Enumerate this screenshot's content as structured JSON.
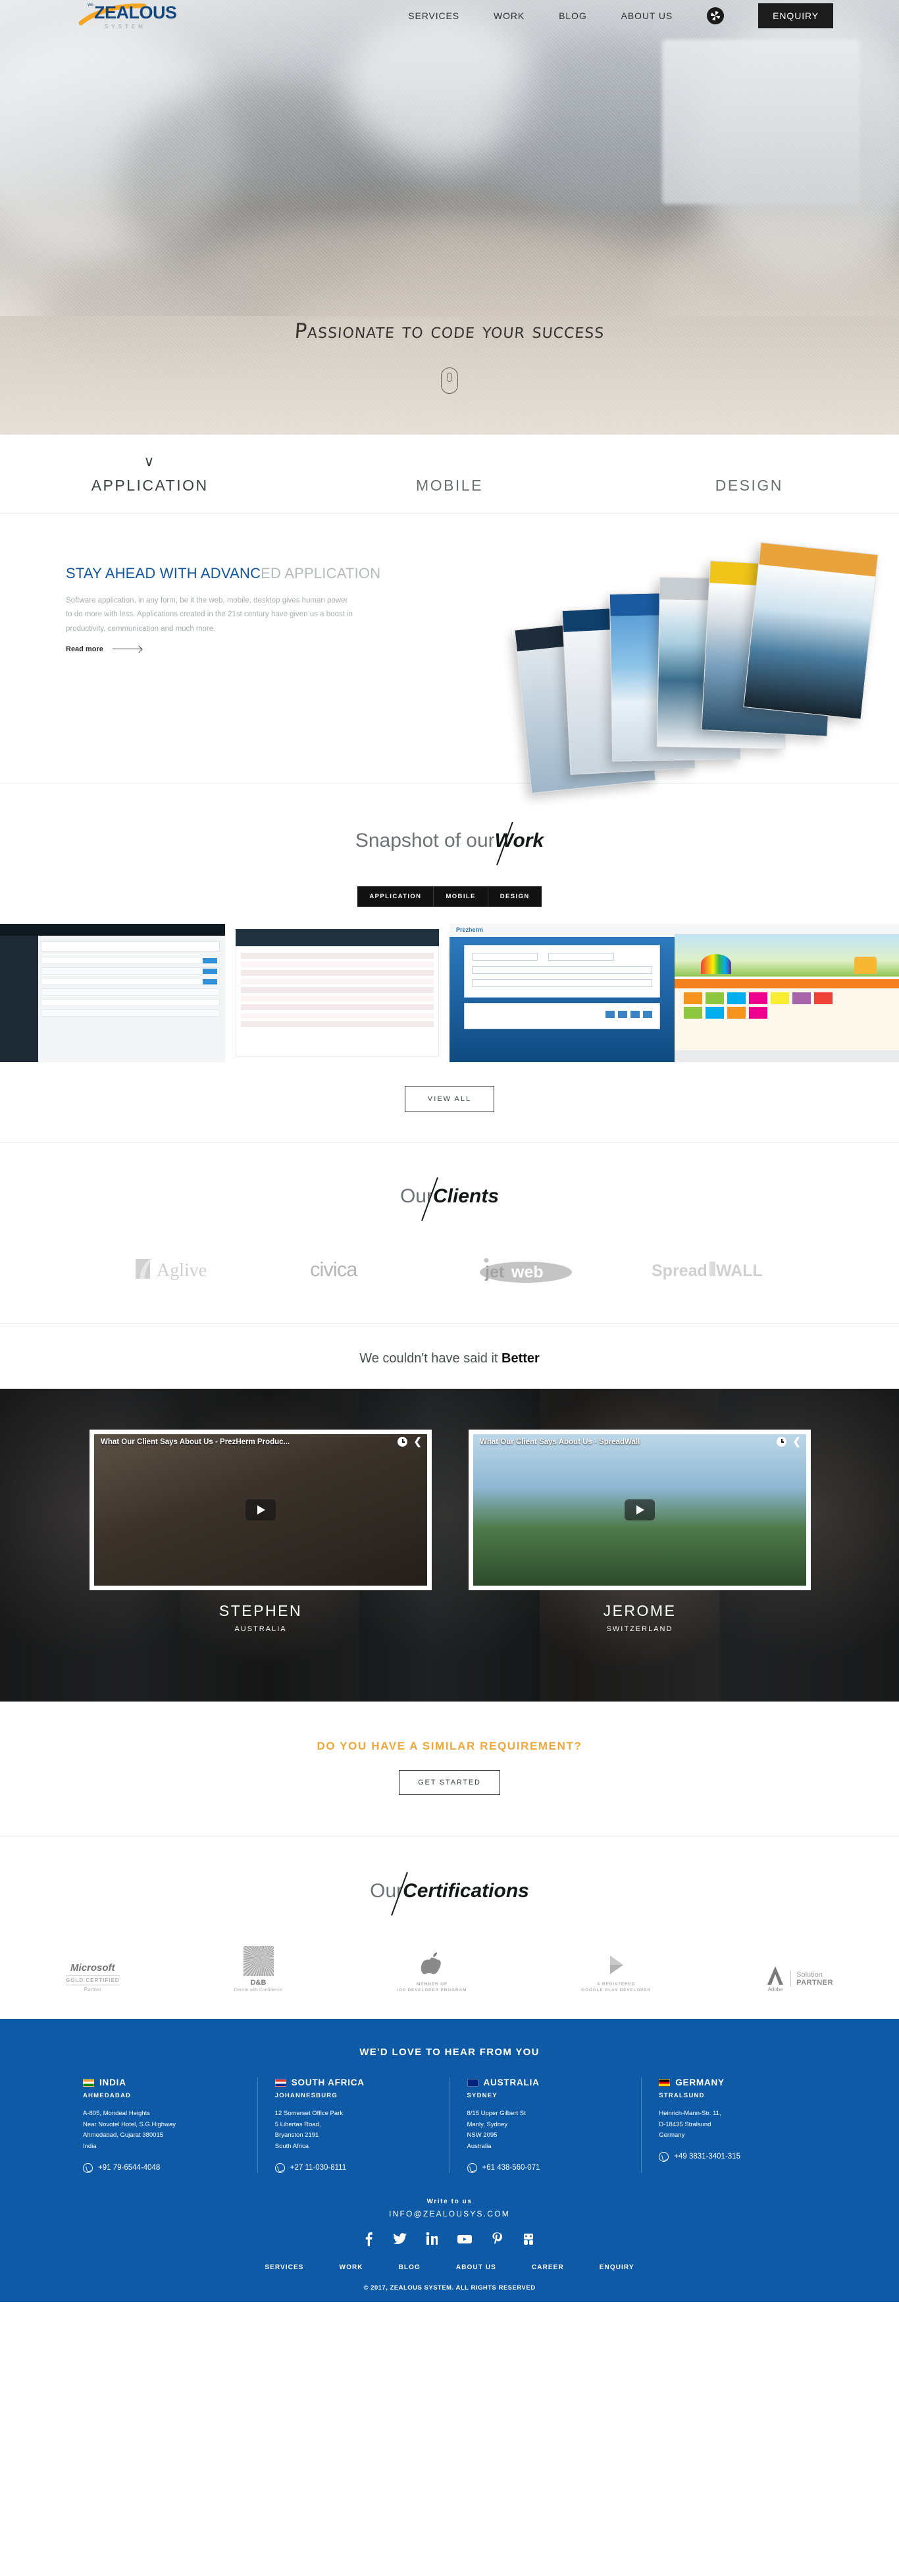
{
  "brand": {
    "name": "ZEALOUS",
    "sub": "SYSTEM",
    "prefix": "We"
  },
  "nav": {
    "items": [
      {
        "label": "SERVICES"
      },
      {
        "label": "WORK"
      },
      {
        "label": "BLOG"
      },
      {
        "label": "ABOUT US"
      }
    ],
    "camera_icon": "aperture-icon",
    "enquiry": "ENQUIRY"
  },
  "hero": {
    "tagline": "Passionate to code your success",
    "scroll_icon": "mouse-scroll-icon"
  },
  "service_tabs": [
    {
      "label": "APPLICATION",
      "active": true
    },
    {
      "label": "MOBILE",
      "active": false
    },
    {
      "label": "DESIGN",
      "active": false
    }
  ],
  "service_panel": {
    "heading_strong": "STAY AHEAD WITH ADVANC",
    "heading_rest": "ED APPLICATION",
    "body": "Software application, in any form, be it the web, mobile, desktop gives human power to do more with less. Applications created in the 21st century have given us a boost in productivity, communication and much more.",
    "read_more": "Read more"
  },
  "work": {
    "title_light": "Snapshot of our",
    "title_bold": "Work",
    "filters": [
      {
        "label": "APPLICATION"
      },
      {
        "label": "MOBILE"
      },
      {
        "label": "DESIGN"
      }
    ],
    "items": [
      {
        "name": "dashboard-admin-screenshot"
      },
      {
        "name": "data-table-screenshot"
      },
      {
        "name": "prezherm-login-screenshot"
      },
      {
        "name": "kids-education-screenshot"
      }
    ],
    "view_all": "VIEW ALL"
  },
  "clients": {
    "title_light": "Our",
    "title_bold": "Clients",
    "logos": [
      {
        "name": "Aglive"
      },
      {
        "name": "CIVICA"
      },
      {
        "name": "jetweb"
      },
      {
        "name": "SpreadWALL"
      }
    ]
  },
  "testimonials": {
    "heading_light": "We couldn't have said it ",
    "heading_bold": "Better",
    "videos": [
      {
        "video_title": "What Our Client Says About Us - PrezHerm Produc...",
        "name": "STEPHEN",
        "country": "AUSTRALIA",
        "watch_later_icon": "clock-icon",
        "share_icon": "share-icon",
        "play_icon": "youtube-play-icon"
      },
      {
        "video_title": "What Our Client Says About Us - SpreadWall",
        "name": "JEROME",
        "country": "SWITZERLAND",
        "watch_later_icon": "clock-icon",
        "share_icon": "share-icon",
        "play_icon": "youtube-play-icon"
      }
    ]
  },
  "cta": {
    "heading": "DO YOU HAVE A SIMILAR REQUIREMENT?",
    "button": "GET STARTED"
  },
  "certifications": {
    "title_light": "Our",
    "title_bold": "Certifications",
    "items": [
      {
        "name": "Microsoft",
        "line1": "GOLD CERTIFIED",
        "line2": "Partner"
      },
      {
        "name": "D&B",
        "line1": "Decide with Confidence",
        "line2": ""
      },
      {
        "name": "Apple",
        "line1": "MEMBER OF",
        "line2": "iOS DEVELOPER PROGRAM"
      },
      {
        "name": "Google Play",
        "line1": "A REGISTERED",
        "line2": "GOOGLE PLAY DEVELOPER"
      },
      {
        "name": "Adobe",
        "line1": "Solution",
        "line2": "PARTNER"
      }
    ]
  },
  "footer": {
    "heading": "WE'D LOVE TO HEAR FROM YOU",
    "offices": [
      {
        "country": "INDIA",
        "flag": "flag-india",
        "city": "AHMEDABAD",
        "address": "A-805, Mondeal Heights\nNear Novotel Hotel, S.G.Highway\nAhmedabad, Gujarat 380015\nIndia",
        "phone": "+91 79-6544-4048"
      },
      {
        "country": "SOUTH AFRICA",
        "flag": "flag-south-africa",
        "city": "JOHANNESBURG",
        "address": "12 Somerset Office Park\n5 Libertas Road,\nBryanston 2191\nSouth Africa",
        "phone": "+27 11-030-8111"
      },
      {
        "country": "AUSTRALIA",
        "flag": "flag-australia",
        "city": "SYDNEY",
        "address": "8/15 Upper Gilbert St\nManly, Sydney\nNSW 2095\nAustralia",
        "phone": "+61 438-560-071"
      },
      {
        "country": "GERMANY",
        "flag": "flag-germany",
        "city": "STRALSUND",
        "address": "Heinrich-Mann-Str. 11,\nD-18435 Stralsund\nGermany",
        "phone": "+49 3831-3401-315"
      }
    ],
    "write_to_us": "Write to us",
    "email": "INFO@ZEALOUSYS.COM",
    "social": [
      {
        "name": "facebook-icon",
        "glyph": "f"
      },
      {
        "name": "twitter-icon",
        "glyph": "t"
      },
      {
        "name": "linkedin-icon",
        "glyph": "in"
      },
      {
        "name": "youtube-icon",
        "glyph": "yt"
      },
      {
        "name": "pinterest-icon",
        "glyph": "p"
      },
      {
        "name": "slideshare-icon",
        "glyph": "ss"
      }
    ],
    "links": [
      {
        "label": "SERVICES"
      },
      {
        "label": "WORK"
      },
      {
        "label": "BLOG"
      },
      {
        "label": "ABOUT US"
      },
      {
        "label": "CAREER"
      },
      {
        "label": "ENQUIRY"
      }
    ],
    "copyright": "© 2017, ZEALOUS SYSTEM. ALL RIGHTS RESERVED",
    "bg_color": "#0e5aa7"
  }
}
